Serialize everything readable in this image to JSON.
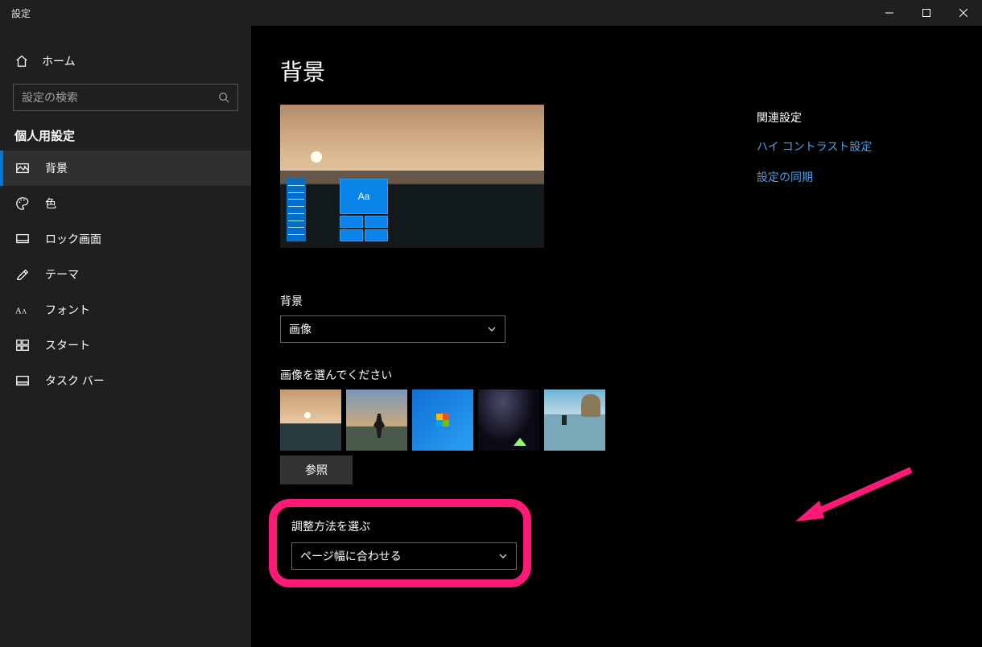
{
  "window": {
    "title": "設定"
  },
  "sidebar": {
    "home": "ホーム",
    "search_placeholder": "設定の検索",
    "category": "個人用設定",
    "items": [
      {
        "label": "背景"
      },
      {
        "label": "色"
      },
      {
        "label": "ロック画面"
      },
      {
        "label": "テーマ"
      },
      {
        "label": "フォント"
      },
      {
        "label": "スタート"
      },
      {
        "label": "タスク バー"
      }
    ]
  },
  "page": {
    "title": "背景",
    "preview_sample": "Aa",
    "bg_label": "背景",
    "bg_value": "画像",
    "choose_image_label": "画像を選んでください",
    "browse": "参照",
    "fit_label": "調整方法を選ぶ",
    "fit_value": "ページ幅に合わせる"
  },
  "related": {
    "title": "関連設定",
    "links": [
      "ハイ コントラスト設定",
      "設定の同期"
    ]
  }
}
